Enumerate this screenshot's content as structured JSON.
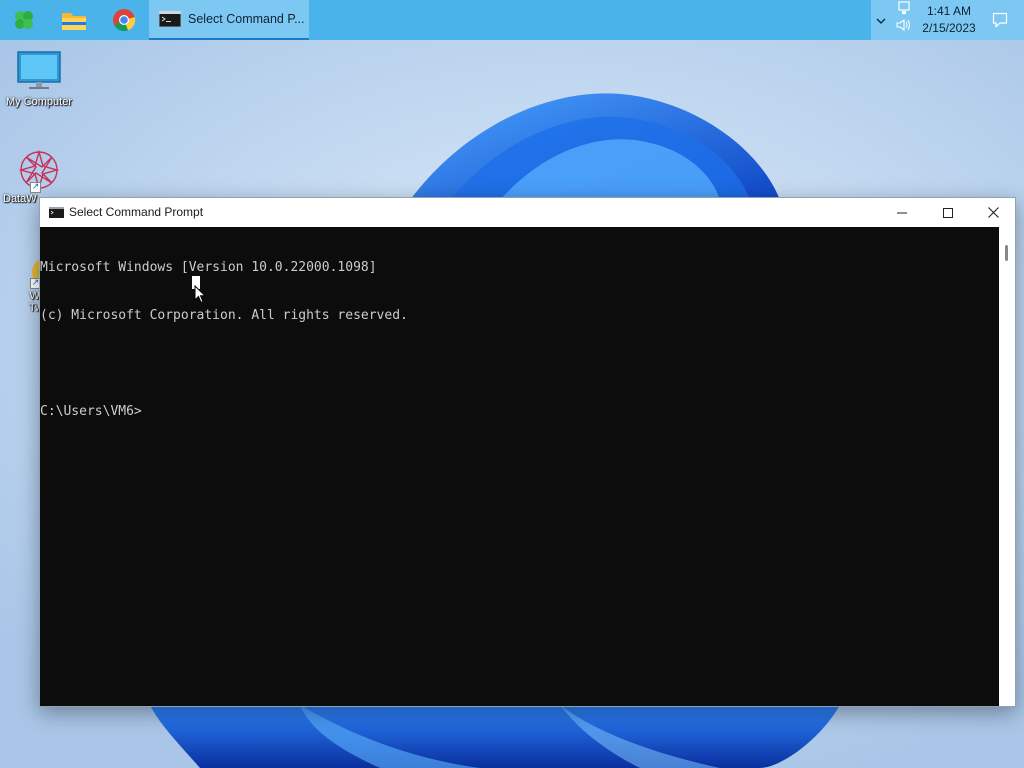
{
  "taskbar": {
    "pinned": [
      {
        "name": "clover-start-icon",
        "color": "#3fbf4e"
      },
      {
        "name": "file-explorer-icon",
        "color": "#f5c242"
      },
      {
        "name": "chrome-icon",
        "color": "#db4437"
      }
    ],
    "active_task": {
      "label": "Select Command P...",
      "icon": "cmd-icon"
    },
    "tray": {
      "icons": [
        "chevron-up-icon",
        "network-icon",
        "volume-icon",
        "notification-icon"
      ],
      "time": "1:41 AM",
      "date": "2/15/2023"
    }
  },
  "desktop": {
    "icons": [
      {
        "label": "My Computer",
        "icon": "monitor-icon"
      },
      {
        "label": "DataW",
        "icon": "datawrapper-icon"
      },
      {
        "label": "Win",
        "label2": "Twe",
        "icon": "winaero-tweaker-icon"
      }
    ]
  },
  "window": {
    "title": "Select Command Prompt",
    "controls": [
      "minimize-icon",
      "maximize-icon",
      "close-icon"
    ],
    "console_lines": [
      "Microsoft Windows [Version 10.0.22000.1098]",
      "(c) Microsoft Corporation. All rights reserved.",
      "",
      "C:\\Users\\VM6>"
    ]
  },
  "colors": {
    "taskbar": "#4ab3ea",
    "console_bg": "#0c0c0c",
    "console_text": "#cccccc",
    "bloom": "#1a6fe8"
  }
}
